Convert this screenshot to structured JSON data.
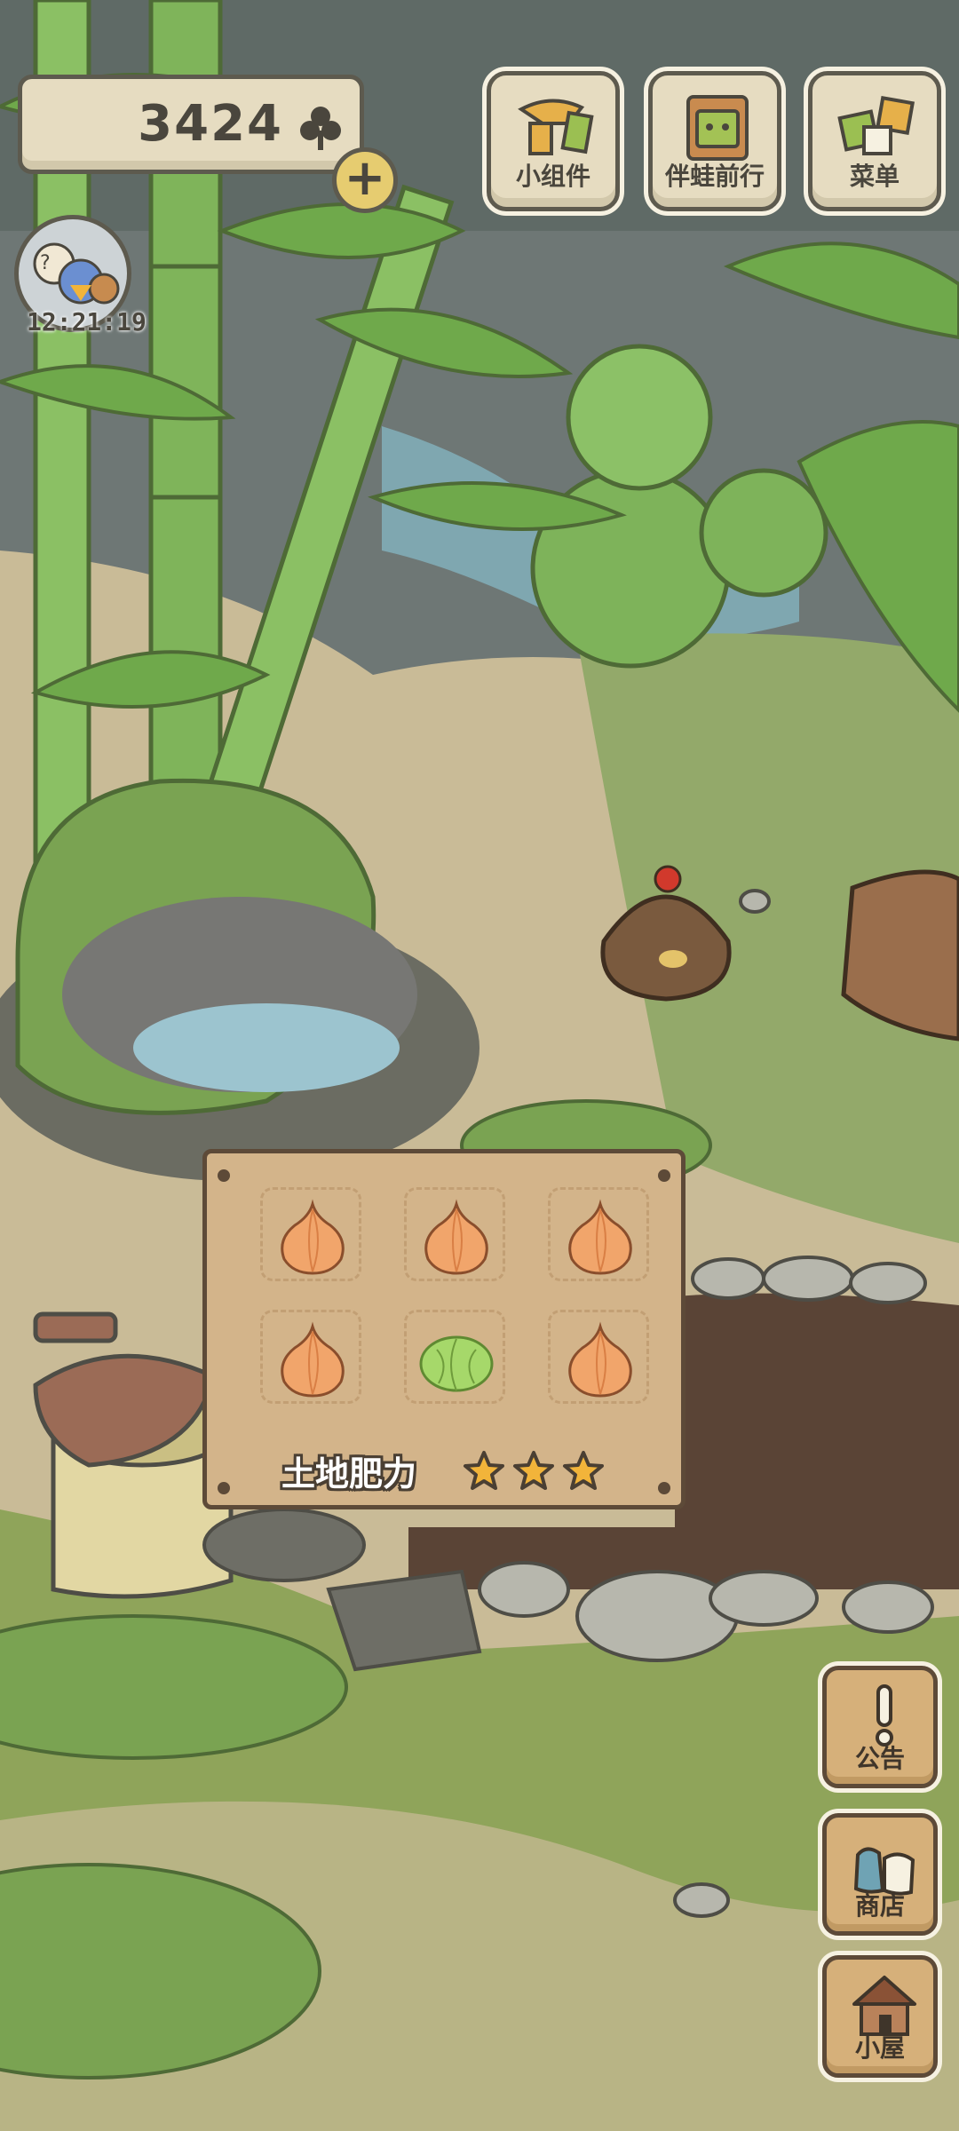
{
  "hud": {
    "clover_count": "3424",
    "clover_icon": "clover-icon",
    "add_icon": "plus-icon",
    "timer": "12:21:19"
  },
  "top_menu": [
    {
      "label": "小组件",
      "icon": "widget-icon"
    },
    {
      "label": "伴蛙前行",
      "icon": "frog-journey-icon"
    },
    {
      "label": "菜单",
      "icon": "menu-cards-icon"
    }
  ],
  "garden": {
    "crops": [
      "onion",
      "onion",
      "onion",
      "onion",
      "cabbage",
      "onion"
    ],
    "fertility_label": "土地肥力",
    "fertility_stars": 3
  },
  "side_menu": [
    {
      "label": "公告",
      "icon": "notice-exclamation-icon"
    },
    {
      "label": "商店",
      "icon": "shop-bags-icon"
    },
    {
      "label": "小屋",
      "icon": "house-icon"
    }
  ],
  "colors": {
    "grass": "#8fa45a",
    "path": "#c9bb97",
    "board": "#d3b48a",
    "panel": "#e6dcc1",
    "outline": "#5d5a4e",
    "star": "#f2b43a"
  }
}
